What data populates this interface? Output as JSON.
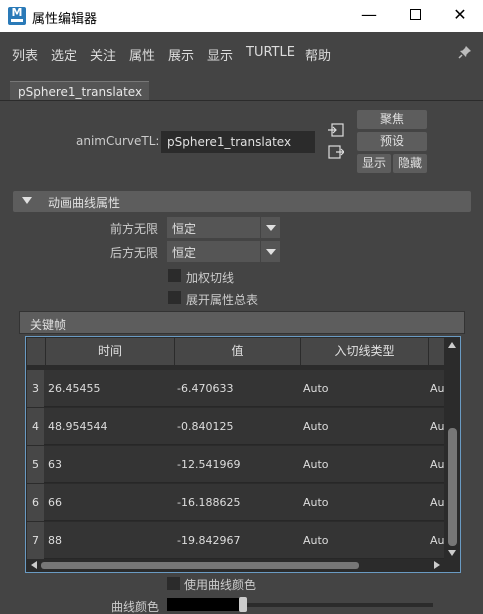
{
  "window": {
    "title": "属性编辑器",
    "app_icon_letter": "M",
    "minimize": "—",
    "close": "✕"
  },
  "menu": [
    "列表",
    "选定",
    "关注",
    "属性",
    "展示",
    "显示",
    "TURTLE",
    "帮助"
  ],
  "tab": "pSphere1_translatex",
  "node": {
    "label": "animCurveTL:",
    "value": "pSphere1_translatex"
  },
  "buttons": {
    "focus": "聚焦",
    "presets": "预设",
    "show": "显示",
    "hide": "隐藏"
  },
  "section": {
    "title": "动画曲线属性",
    "pre_infinity_label": "前方无限",
    "pre_infinity_value": "恒定",
    "post_infinity_label": "后方无限",
    "post_infinity_value": "恒定",
    "weighted_tangents": "加权切线",
    "expand_all": "展开属性总表"
  },
  "keyframes": {
    "title": "关键帧",
    "columns": [
      "时间",
      "值",
      "入切线类型"
    ],
    "rows": [
      {
        "index": "3",
        "time": "26.45455",
        "value": "-6.470633",
        "in_tangent": "Auto",
        "out_tangent": "Aut"
      },
      {
        "index": "4",
        "time": "48.954544",
        "value": "-0.840125",
        "in_tangent": "Auto",
        "out_tangent": "Aut"
      },
      {
        "index": "5",
        "time": "63",
        "value": "-12.541969",
        "in_tangent": "Auto",
        "out_tangent": "Aut"
      },
      {
        "index": "6",
        "time": "66",
        "value": "-16.188625",
        "in_tangent": "Auto",
        "out_tangent": "Aut"
      },
      {
        "index": "7",
        "time": "88",
        "value": "-19.842967",
        "in_tangent": "Auto",
        "out_tangent": "Aut"
      }
    ]
  },
  "curve_color": {
    "use_curve_color": "使用曲线颜色",
    "label": "曲线颜色",
    "swatch_color": "#000000",
    "slider_position": 0.0
  },
  "colors": {
    "accent": "#2a7ab8",
    "table_focus_border": "#6a9bc3"
  }
}
